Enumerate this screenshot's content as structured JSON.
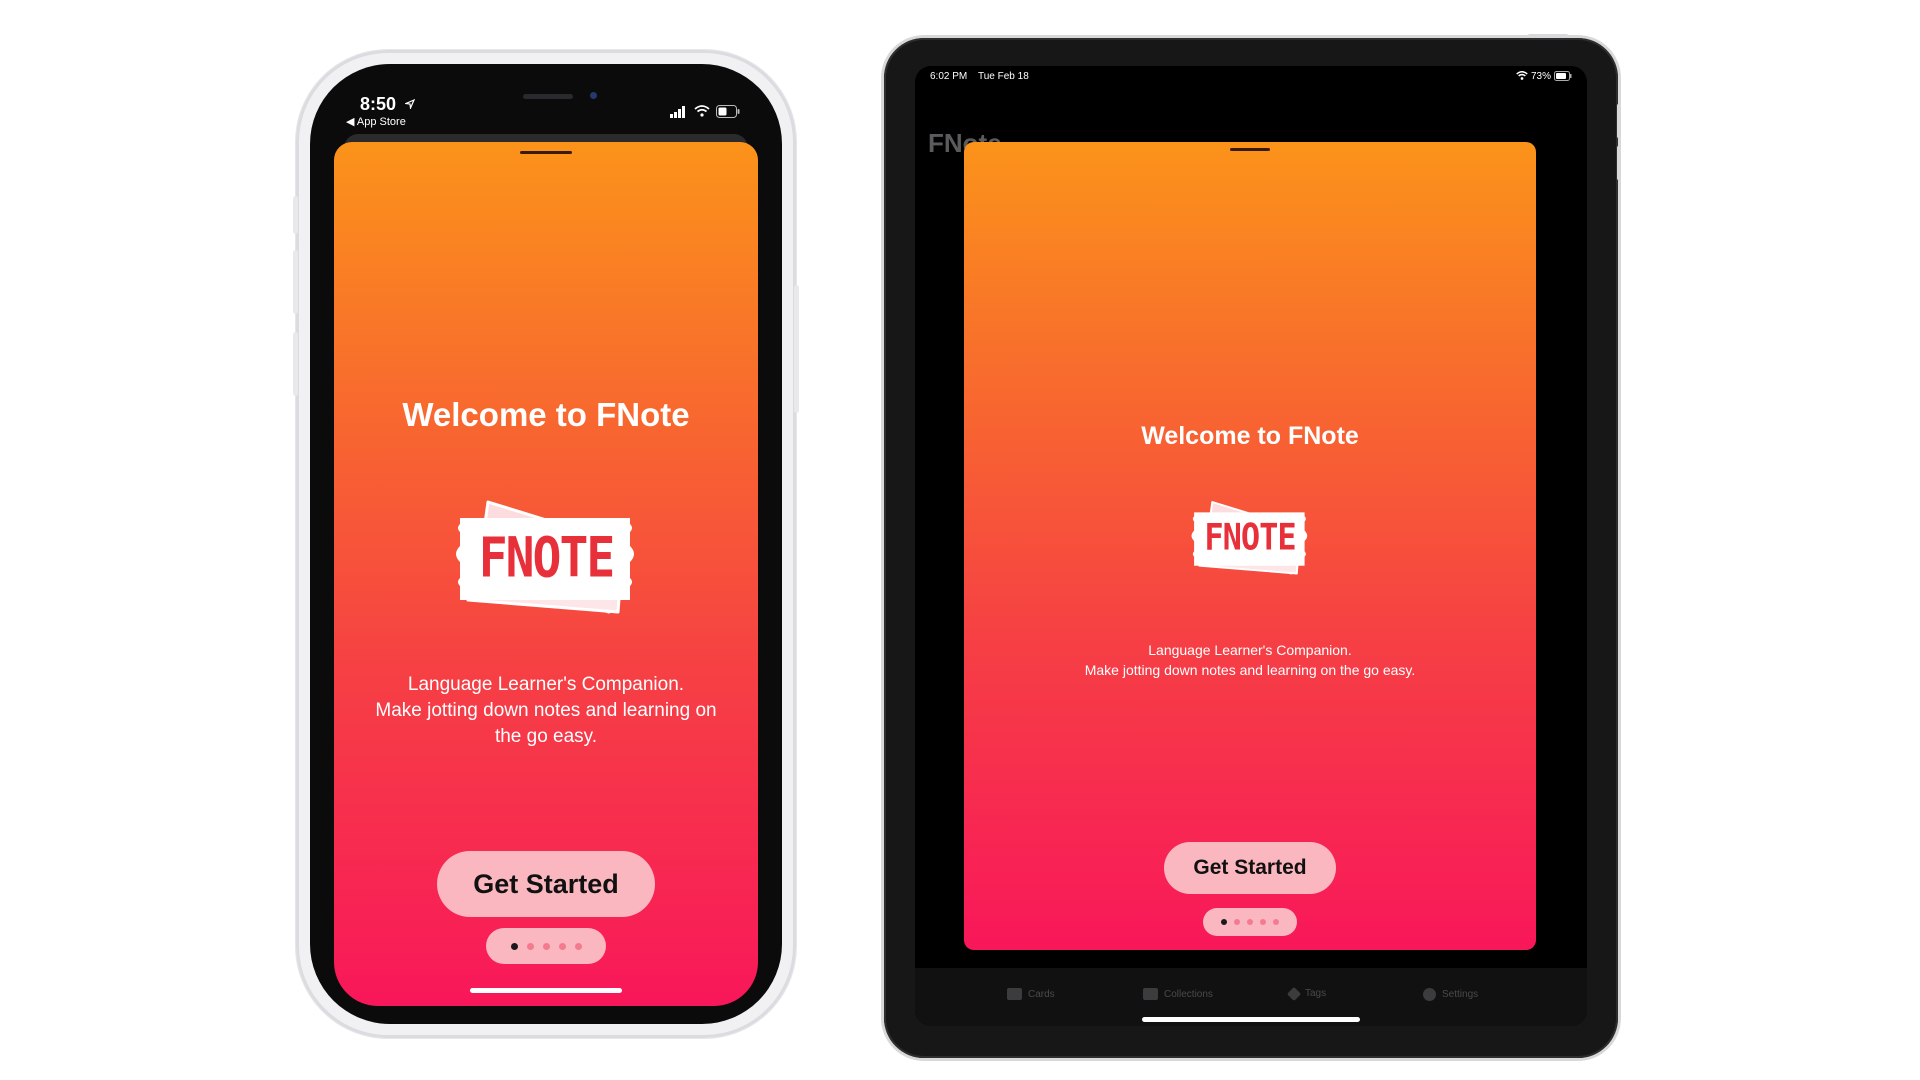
{
  "phone": {
    "status": {
      "time": "8:50",
      "back_label": "◀ App Store"
    },
    "onboarding": {
      "title": "Welcome to FNote",
      "logo_text": "FNOTE",
      "tagline": "Language Learner's Companion.",
      "description": "Make jotting down notes and learning on the go easy.",
      "cta": "Get Started",
      "page_count": 5,
      "current_page": 1
    }
  },
  "tablet": {
    "status": {
      "time": "6:02 PM",
      "date": "Tue Feb 18",
      "battery": "73%"
    },
    "background_title": "FNote",
    "onboarding": {
      "title": "Welcome to FNote",
      "logo_text": "FNOTE",
      "tagline": "Language Learner's Companion.",
      "description": "Make jotting down notes and learning on the go easy.",
      "cta": "Get Started",
      "page_count": 5,
      "current_page": 1
    },
    "tabs": [
      {
        "label": "Cards",
        "icon": "cards-icon"
      },
      {
        "label": "Collections",
        "icon": "collections-icon"
      },
      {
        "label": "Tags",
        "icon": "tag-icon"
      },
      {
        "label": "Settings",
        "icon": "settings-icon"
      }
    ]
  },
  "colors": {
    "gradient_top": "#fb931a",
    "gradient_bottom": "#f8175a",
    "button_bg": "#fbb7c0",
    "logo_red": "#e8303a"
  }
}
